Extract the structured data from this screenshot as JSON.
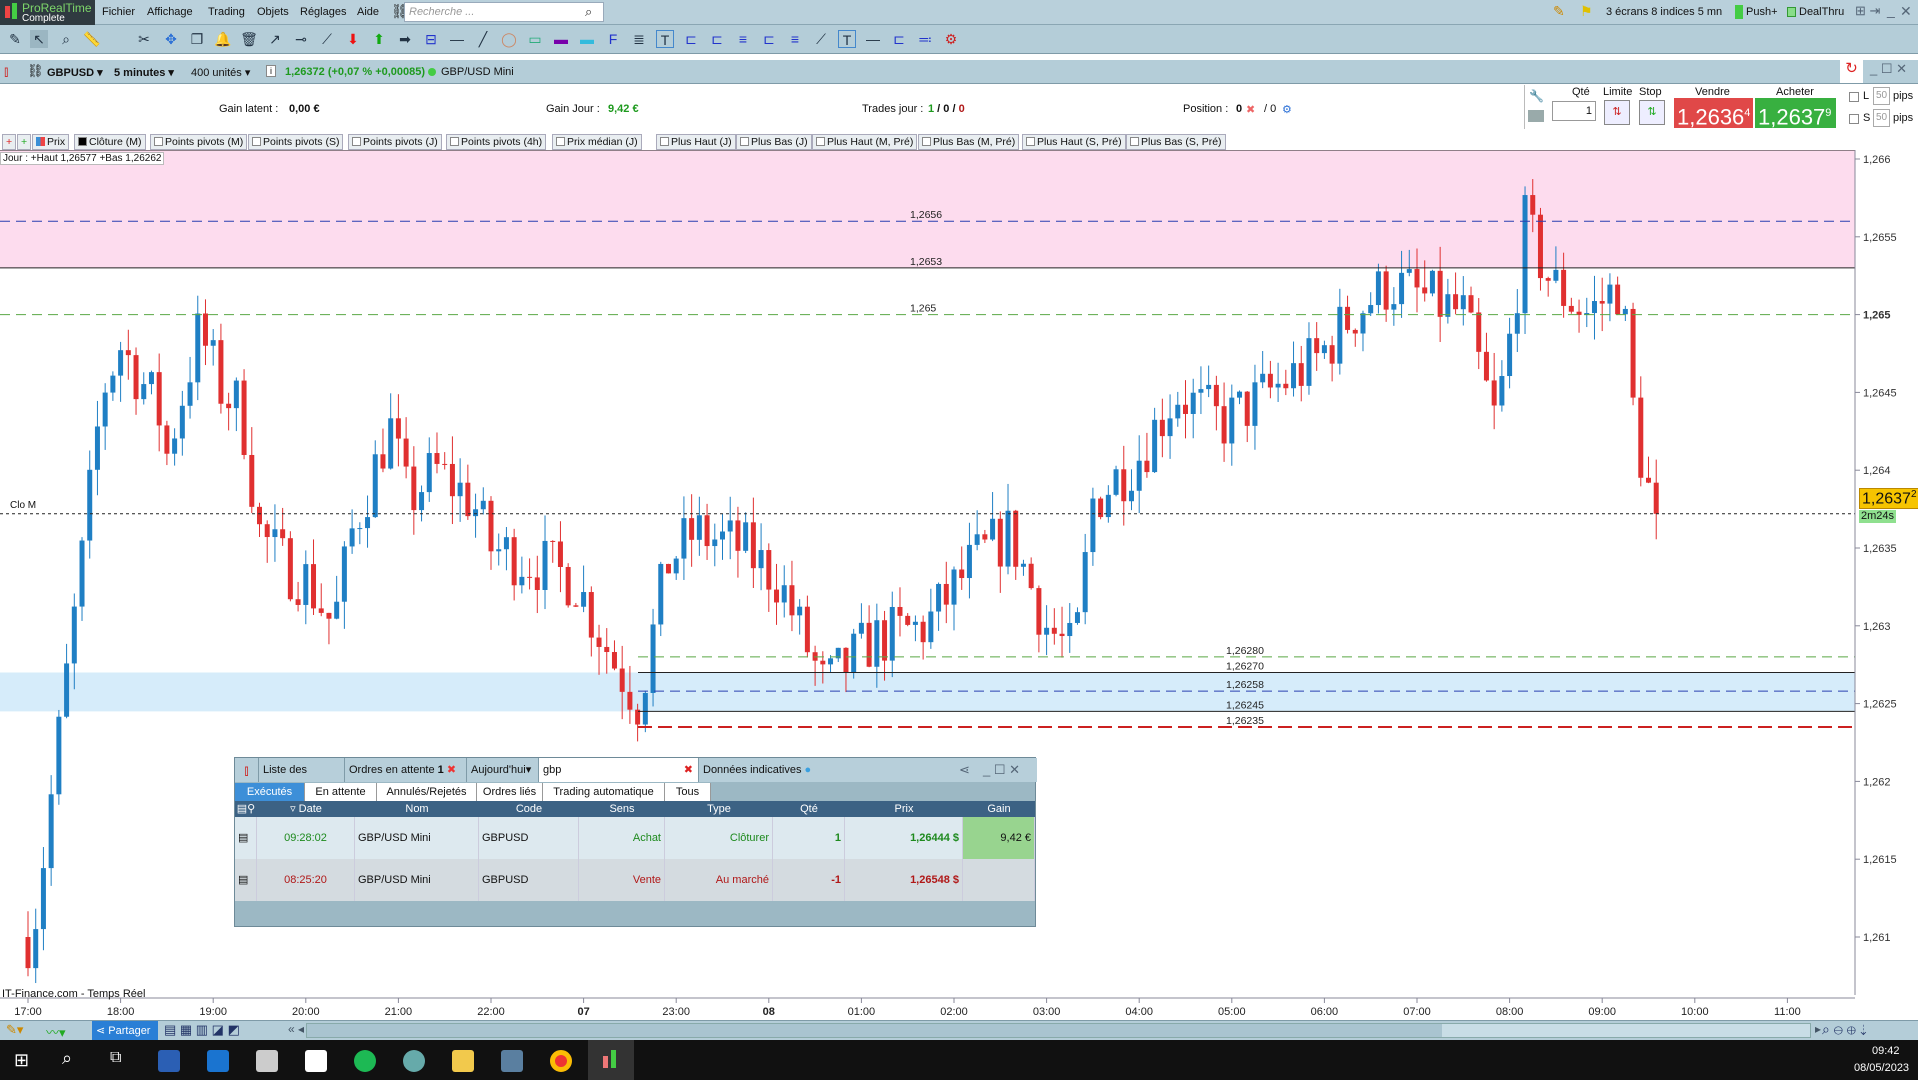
{
  "app": {
    "brand": "ProRealTime",
    "edition": "Complete"
  },
  "menu": [
    "Fichier",
    "Affichage",
    "Trading",
    "Objets",
    "Réglages",
    "Aide"
  ],
  "search": {
    "placeholder": "Recherche ..."
  },
  "topright": {
    "screens": "3 écrans 8 indices 5 mn",
    "push": "Push+",
    "dealthru": "DealThru"
  },
  "symbol": {
    "ticker": "GBPUSD",
    "timeframe": "5 minutes",
    "units": "400 unités",
    "quote": "1,26372 (+0,07 % +0,00085)",
    "name": "GBP/USD Mini"
  },
  "info": {
    "gain_latent_label": "Gain latent :",
    "gain_latent": "0,00 €",
    "gain_jour_label": "Gain Jour :",
    "gain_jour": "9,42 €",
    "trades_label": "Trades jour :",
    "trades_a": "1",
    "trades_b": " / 0 / ",
    "trades_c": "0",
    "position_label": "Position :",
    "position_a": "0",
    "position_b": "/ 0"
  },
  "ticket": {
    "qty_label": "Qté",
    "qty": "1",
    "limit_label": "Limite",
    "stop_label": "Stop",
    "sell_label": "Vendre",
    "sell_price": "1,2636",
    "sell_pip": "4",
    "buy_label": "Acheter",
    "buy_price": "1,2637",
    "buy_pip": "9",
    "l": "L",
    "s": "S",
    "pips": "50",
    "pips_label": "pips"
  },
  "indicators": [
    "Prix",
    "Clôture (M)",
    "Points pivots (M)",
    "Points pivots (S)",
    "Points pivots (J)",
    "Points pivots (4h)",
    "Prix médian (J)",
    "Plus Haut (J)",
    "Plus Bas (J)",
    "Plus Haut (M, Pré)",
    "Plus Bas (M, Pré)",
    "Plus Haut (S, Pré)",
    "Plus Bas (S, Pré)"
  ],
  "chart_data": {
    "type": "candlestick",
    "day_info": "Jour : +Haut 1,26577 +Bas 1,26262",
    "source": "IT-Finance.com - Temps Réel",
    "close_label": "Clo M",
    "y_ticks": [
      "1,266",
      "1,2655",
      "1,265",
      "1,2645",
      "1,264",
      "1,2635",
      "1,263",
      "1,2625",
      "1,262",
      "1,2615",
      "1,261"
    ],
    "y_values": [
      1.266,
      1.2655,
      1.265,
      1.2645,
      1.264,
      1.2635,
      1.263,
      1.2625,
      1.262,
      1.2615,
      1.261
    ],
    "x_ticks": [
      "17:00",
      "18:00",
      "19:00",
      "20:00",
      "21:00",
      "22:00",
      "07",
      "23:00",
      "08",
      "01:00",
      "02:00",
      "03:00",
      "04:00",
      "05:00",
      "06:00",
      "07:00",
      "08:00",
      "09:00",
      "10:00",
      "11:00"
    ],
    "last_price": "1,2637",
    "last_pip": "2",
    "countdown": "2m24s",
    "levels": [
      {
        "label": "1,2656",
        "value": 1.2656,
        "style": "dashed",
        "color": "#2a3fb0"
      },
      {
        "label": "1,2653",
        "value": 1.2653,
        "style": "solid",
        "color": "#222222"
      },
      {
        "label": "1,265",
        "value": 1.265,
        "style": "dashed",
        "color": "#5aa845"
      },
      {
        "label": "1,26280",
        "value": 1.2628,
        "style": "dashed",
        "color": "#5aa845"
      },
      {
        "label": "1,26270",
        "value": 1.2627,
        "style": "solid",
        "color": "#222222"
      },
      {
        "label": "1,26258",
        "value": 1.26258,
        "style": "dashed",
        "color": "#2a3fb0"
      },
      {
        "label": "1,26245",
        "value": 1.26245,
        "style": "solid",
        "color": "#222222"
      },
      {
        "label": "1,26235",
        "value": 1.26235,
        "style": "bolddash",
        "color": "#cc2020"
      }
    ],
    "zones": [
      {
        "from": 1.2653,
        "to": 1.2662,
        "color": "#fddcee"
      },
      {
        "from": 1.26245,
        "to": 1.2627,
        "color": "#d6ecfa"
      }
    ],
    "close_line": 1.26372,
    "path": [
      [
        0,
        1.261
      ],
      [
        0.1,
        1.2612
      ],
      [
        0.4,
        1.2626
      ],
      [
        0.6,
        1.2635
      ],
      [
        0.8,
        1.2645
      ],
      [
        1.0,
        1.2648
      ],
      [
        1.4,
        1.2644
      ],
      [
        1.5,
        1.2641
      ],
      [
        1.85,
        1.2649
      ],
      [
        2.1,
        1.2645
      ],
      [
        2.3,
        1.2644
      ],
      [
        2.5,
        1.2636
      ],
      [
        2.75,
        1.2634
      ],
      [
        3.0,
        1.2633
      ],
      [
        3.3,
        1.263
      ],
      [
        3.5,
        1.2636
      ],
      [
        3.8,
        1.2641
      ],
      [
        3.9,
        1.2643
      ],
      [
        4.1,
        1.2638
      ],
      [
        4.4,
        1.264
      ],
      [
        4.8,
        1.2638
      ],
      [
        5.0,
        1.2635
      ],
      [
        5.5,
        1.2634
      ],
      [
        5.9,
        1.2633
      ],
      [
        6.3,
        1.2628
      ],
      [
        6.6,
        1.2625
      ],
      [
        6.9,
        1.2634
      ],
      [
        7.2,
        1.2636
      ],
      [
        7.7,
        1.2635
      ],
      [
        8.1,
        1.2633
      ],
      [
        8.6,
        1.2626
      ],
      [
        9.1,
        1.2629
      ],
      [
        9.7,
        1.263
      ],
      [
        10.2,
        1.2634
      ],
      [
        10.6,
        1.2636
      ],
      [
        11.0,
        1.263
      ],
      [
        11.3,
        1.2628
      ],
      [
        11.5,
        1.2638
      ],
      [
        12.0,
        1.2641
      ],
      [
        12.4,
        1.2645
      ],
      [
        12.9,
        1.2643
      ],
      [
        13.4,
        1.2645
      ],
      [
        13.9,
        1.2647
      ],
      [
        14.3,
        1.265
      ],
      [
        14.7,
        1.2652
      ],
      [
        15.1,
        1.2651
      ],
      [
        15.5,
        1.265
      ],
      [
        15.85,
        1.2643
      ],
      [
        16.05,
        1.265
      ],
      [
        16.15,
        1.2656
      ],
      [
        16.45,
        1.2652
      ],
      [
        16.85,
        1.265
      ],
      [
        17.2,
        1.2652
      ],
      [
        17.35,
        1.2643
      ],
      [
        17.48,
        1.2639
      ],
      [
        17.6,
        1.26372
      ]
    ]
  },
  "orders": {
    "tabs_top": {
      "list": "Liste des ordres",
      "pending": "Ordres en attente",
      "pending_count": "1",
      "period": "Aujourd'hui",
      "filter": "gbp",
      "indicative": "Données indicatives"
    },
    "tabs": [
      "Exécutés",
      "En attente",
      "Annulés/Rejetés",
      "Ordres liés",
      "Trading automatique",
      "Tous"
    ],
    "columns": [
      "Date",
      "Nom",
      "Code",
      "Sens",
      "Type",
      "Qté",
      "Prix",
      "Gain"
    ],
    "rows": [
      {
        "date": "09:28:02",
        "name": "GBP/USD Mini",
        "code": "GBPUSD",
        "side": "Achat",
        "type": "Clôturer",
        "qty": "1",
        "price": "1,26444 $",
        "gain": "9,42 €",
        "color": "#1e8a1e"
      },
      {
        "date": "08:25:20",
        "name": "GBP/USD Mini",
        "code": "GBPUSD",
        "side": "Vente",
        "type": "Au marché",
        "qty": "-1",
        "price": "1,26548 $",
        "gain": "",
        "color": "#b01818"
      }
    ]
  },
  "bottom": {
    "share": "Partager"
  },
  "taskbar": {
    "time": "09:42",
    "date": "08/05/2023"
  }
}
